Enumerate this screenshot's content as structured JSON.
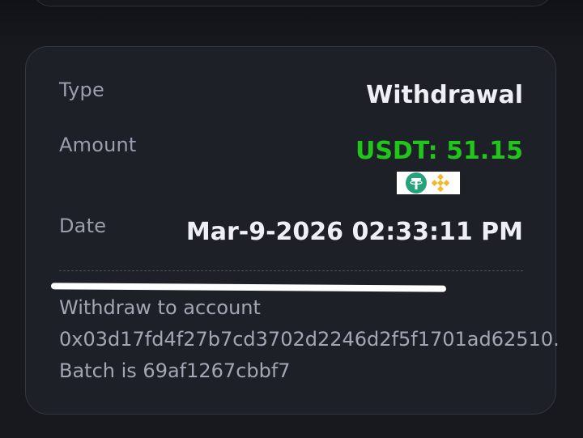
{
  "details": {
    "type_label": "Type",
    "type_value": "Withdrawal",
    "amount_label": "Amount",
    "amount_value": "USDT: 51.15",
    "date_label": "Date",
    "date_value": "Mar-9-2026 02:33:11 PM",
    "memo_line1": "Withdraw to account",
    "memo_line2": "0x03d17fd4f27b7cd3702d2246d2f5f1701ad62510.",
    "memo_line3": "Batch is 69af1267cbbf7",
    "network_icons": [
      "tether-icon",
      "bnb-icon"
    ]
  },
  "colors": {
    "background": "#17191f",
    "card": "#1e2028",
    "amount_green": "#22c51c",
    "label_gray": "#9a9fae"
  }
}
